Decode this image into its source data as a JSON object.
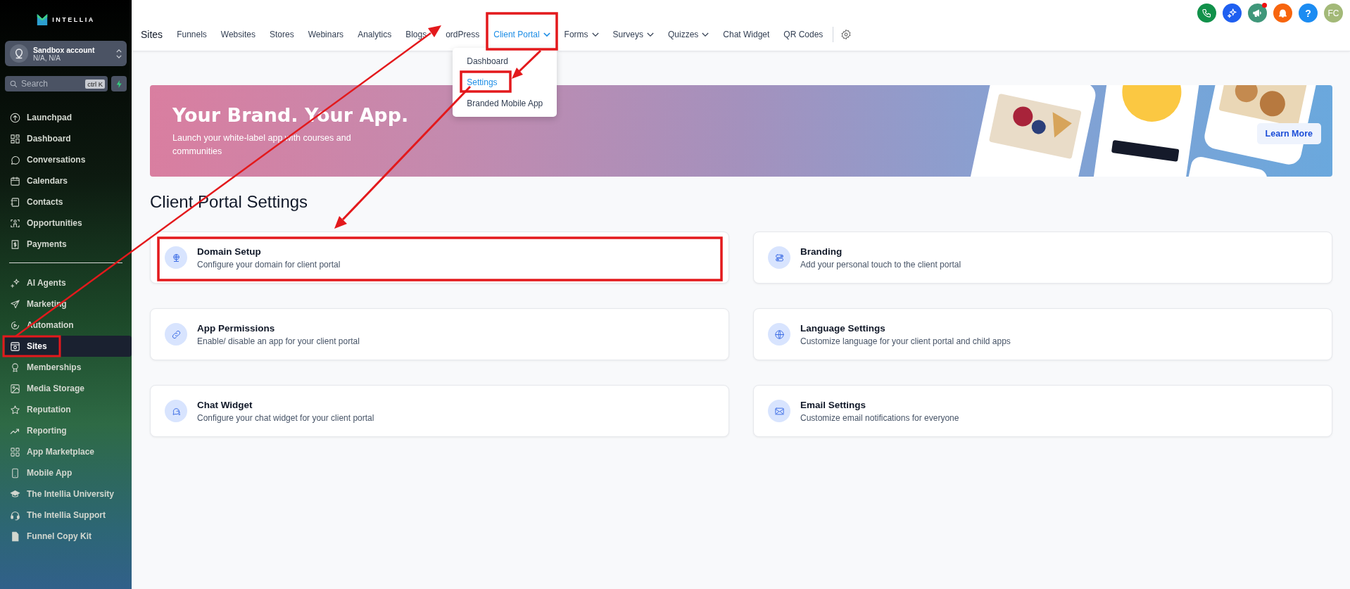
{
  "sidebar": {
    "logo": "INTELLIA",
    "account": {
      "name": "Sandbox account",
      "location": "N/A, N/A"
    },
    "search": {
      "placeholder": "Search",
      "shortcut": "ctrl K"
    },
    "groups": [
      {
        "items": [
          {
            "label": "Launchpad",
            "selected": false
          },
          {
            "label": "Dashboard",
            "selected": false
          },
          {
            "label": "Conversations",
            "selected": false
          },
          {
            "label": "Calendars",
            "selected": false
          },
          {
            "label": "Contacts",
            "selected": false
          },
          {
            "label": "Opportunities",
            "selected": false
          },
          {
            "label": "Payments",
            "selected": false
          }
        ]
      },
      {
        "items": [
          {
            "label": "AI Agents",
            "selected": false
          },
          {
            "label": "Marketing",
            "selected": false
          },
          {
            "label": "Automation",
            "selected": false
          },
          {
            "label": "Sites",
            "selected": true
          },
          {
            "label": "Memberships",
            "selected": false
          },
          {
            "label": "Media Storage",
            "selected": false
          },
          {
            "label": "Reputation",
            "selected": false
          },
          {
            "label": "Reporting",
            "selected": false
          },
          {
            "label": "App Marketplace",
            "selected": false
          },
          {
            "label": "Mobile App",
            "selected": false
          },
          {
            "label": "The Intellia University",
            "selected": false
          },
          {
            "label": "The Intellia Support",
            "selected": false
          },
          {
            "label": "Funnel Copy Kit",
            "selected": false
          }
        ]
      }
    ]
  },
  "header": {
    "title": "Sites",
    "help": "?",
    "user_initials": "FC",
    "megaphone_unread": true,
    "nav": [
      {
        "label": "Funnels",
        "selected": false,
        "has_menu": false
      },
      {
        "label": "Websites",
        "selected": false,
        "has_menu": false
      },
      {
        "label": "Stores",
        "selected": false,
        "has_menu": false
      },
      {
        "label": "Webinars",
        "selected": false,
        "has_menu": false
      },
      {
        "label": "Analytics",
        "selected": false,
        "has_menu": false
      },
      {
        "label": "Blogs",
        "selected": false,
        "has_menu": false
      },
      {
        "label": "ordPress",
        "selected": false,
        "has_menu": false
      },
      {
        "label": "Client Portal",
        "selected": true,
        "has_menu": true,
        "expanded": true,
        "menu": [
          {
            "label": "Dashboard",
            "selected": false
          },
          {
            "label": "Settings",
            "selected": true
          },
          {
            "label": "Branded Mobile App",
            "selected": false
          }
        ]
      },
      {
        "label": "Forms",
        "selected": false,
        "has_menu": true,
        "expanded": false
      },
      {
        "label": "Surveys",
        "selected": false,
        "has_menu": true,
        "expanded": false
      },
      {
        "label": "Quizzes",
        "selected": false,
        "has_menu": true,
        "expanded": false
      },
      {
        "label": "Chat Widget",
        "selected": false,
        "has_menu": false
      },
      {
        "label": "QR Codes",
        "selected": false,
        "has_menu": false
      }
    ]
  },
  "banner": {
    "title": "Your Brand. Your App.",
    "subtitle": "Launch your white-label app with courses and communities",
    "button": "Learn More"
  },
  "page_title": "Client Portal Settings",
  "cards": [
    {
      "title": "Domain Setup",
      "description": "Configure your domain for client portal"
    },
    {
      "title": "Branding",
      "description": "Add your personal touch to the client portal"
    },
    {
      "title": "App Permissions",
      "description": "Enable/ disable an app for your client portal"
    },
    {
      "title": "Language Settings",
      "description": "Customize language for your client portal and child apps"
    },
    {
      "title": "Chat Widget",
      "description": "Configure your chat widget for your client portal"
    },
    {
      "title": "Email Settings",
      "description": "Customize email notifications for everyone"
    }
  ]
}
